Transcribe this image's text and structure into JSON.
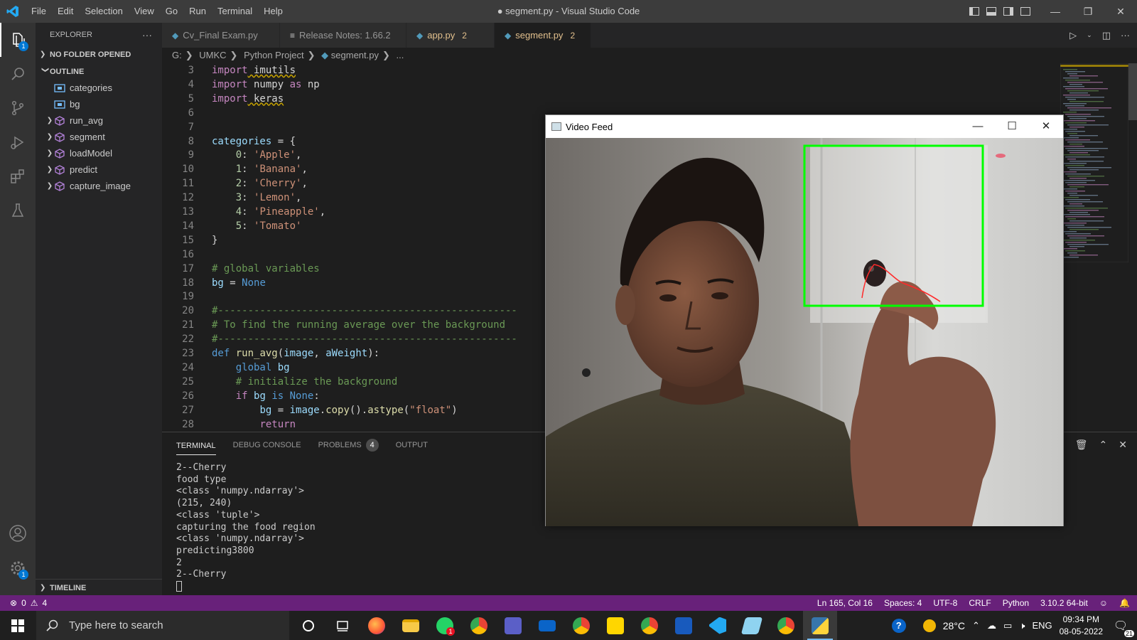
{
  "window": {
    "title": "● segment.py - Visual Studio Code"
  },
  "menu": [
    "File",
    "Edit",
    "Selection",
    "View",
    "Go",
    "Run",
    "Terminal",
    "Help"
  ],
  "window_controls": {
    "minimize": "—",
    "restore": "❐",
    "close": "✕"
  },
  "activity_badges": {
    "explorer": "1",
    "settings": "1"
  },
  "sidebar": {
    "header": "EXPLORER",
    "more": "···",
    "no_folder": "NO FOLDER OPENED",
    "outline_title": "OUTLINE",
    "outline_items": [
      {
        "label": "categories",
        "kind": "variable",
        "expandable": false
      },
      {
        "label": "bg",
        "kind": "variable",
        "expandable": false
      },
      {
        "label": "run_avg",
        "kind": "function",
        "expandable": true
      },
      {
        "label": "segment",
        "kind": "function",
        "expandable": true
      },
      {
        "label": "loadModel",
        "kind": "function",
        "expandable": true
      },
      {
        "label": "predict",
        "kind": "function",
        "expandable": true
      },
      {
        "label": "capture_image",
        "kind": "function",
        "expandable": true
      }
    ],
    "timeline": "TIMELINE"
  },
  "tabs": [
    {
      "label": "Cv_Final Exam.py",
      "icon": "python-icon",
      "count": "",
      "color": "#969696"
    },
    {
      "label": "Release Notes: 1.66.2",
      "icon": "markdown-icon",
      "count": "",
      "color": "#969696"
    },
    {
      "label": "app.py",
      "icon": "python-icon",
      "count": "2",
      "color": "#e2c08d"
    },
    {
      "label": "segment.py",
      "icon": "python-icon",
      "count": "2",
      "color": "#e2c08d",
      "active": true,
      "dirty": true
    }
  ],
  "breadcrumb": [
    "G:",
    "UMKC",
    "Python Project",
    "segment.py",
    "..."
  ],
  "code_line_numbers": [
    "3",
    "4",
    "5",
    "6",
    "7",
    "8",
    "9",
    "10",
    "11",
    "12",
    "13",
    "14",
    "15",
    "16",
    "17",
    "18",
    "19",
    "20",
    "21",
    "22",
    "23",
    "24",
    "25",
    "26",
    "27",
    "28"
  ],
  "code_text": {
    "l3": [
      "import",
      " imutils"
    ],
    "l4": [
      "import",
      " numpy ",
      "as",
      " np"
    ],
    "l5": [
      "import",
      " keras"
    ],
    "l8": [
      "categories",
      " = {"
    ],
    "l9": [
      "    0",
      ": ",
      "'Apple'",
      ","
    ],
    "l10": [
      "    1",
      ": ",
      "'Banana'",
      ","
    ],
    "l11": [
      "    2",
      ": ",
      "'Cherry'",
      ","
    ],
    "l12": [
      "    3",
      ": ",
      "'Lemon'",
      ","
    ],
    "l13": [
      "    4",
      ": ",
      "'Pineapple'",
      ","
    ],
    "l14": [
      "    5",
      ": ",
      "'Tomato'"
    ],
    "l15": [
      "}"
    ],
    "l17": [
      "# global variables"
    ],
    "l18": [
      "bg",
      " = ",
      "None"
    ],
    "l20": [
      "#--------------------------------------------------"
    ],
    "l21": [
      "# To find the running average over the background"
    ],
    "l22": [
      "#--------------------------------------------------"
    ],
    "l23": [
      "def",
      " ",
      "run_avg",
      "(",
      "image",
      ", ",
      "aWeight",
      "):"
    ],
    "l24": [
      "    ",
      "global",
      " ",
      "bg"
    ],
    "l25": [
      "    # initialize the background"
    ],
    "l26": [
      "    ",
      "if",
      " ",
      "bg",
      " ",
      "is",
      " ",
      "None",
      ":"
    ],
    "l27": [
      "        ",
      "bg",
      " = ",
      "image",
      ".",
      "copy",
      "().",
      "astype",
      "(",
      "\"float\"",
      ")"
    ],
    "l28": [
      "        ",
      "return"
    ]
  },
  "panel": {
    "tabs": [
      "TERMINAL",
      "DEBUG CONSOLE",
      "PROBLEMS",
      "OUTPUT"
    ],
    "problems_count": "4",
    "terminal_lines": [
      "2--Cherry",
      "food type",
      "<class 'numpy.ndarray'>",
      "(215, 240)",
      "<class 'tuple'>",
      "capturing the food region",
      "<class 'numpy.ndarray'>",
      "predicting3800",
      "2",
      "2--Cherry"
    ]
  },
  "video_window": {
    "title": "Video Feed",
    "roi_color": "#00ff00"
  },
  "status": {
    "errors": "0",
    "warnings": "4",
    "position": "Ln 165, Col 16",
    "spaces": "Spaces: 4",
    "encoding": "UTF-8",
    "eol": "CRLF",
    "language": "Python",
    "interpreter": "3.10.2 64-bit"
  },
  "taskbar": {
    "search_placeholder": "Type here to search",
    "temperature": "28°C",
    "language": "ENG",
    "time": "09:34 PM",
    "date": "08-05-2022",
    "notifications": "21"
  },
  "colors": {
    "status_bar": "#68217a",
    "activity_badge": "#0078d4",
    "modified_tab": "#e2c08d"
  }
}
